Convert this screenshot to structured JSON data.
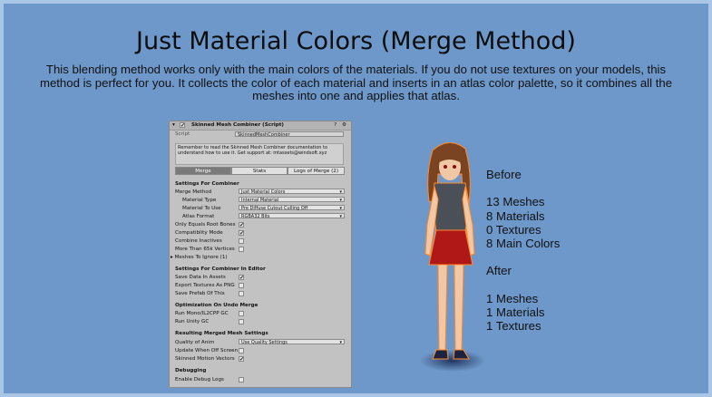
{
  "heading": "Just Material Colors (Merge Method)",
  "description": "This blending method works only with the main colors of the materials. If you do not use textures on your models, this method is perfect for you. It collects the color of each material and inserts in an atlas color palette, so it combines all the meshes into one and applies that atlas.",
  "inspector": {
    "title": "Skinned Mesh Combiner (Script)",
    "script_label": "Script",
    "script_value": "SkinnedMeshCombiner",
    "note": "Remember to read the Skinned Mesh Combiner documentation to understand how to use it. Get support at: mtassets@windsoft.xyz",
    "tabs": [
      "Merge",
      "Stats",
      "Logs of Merge (2)"
    ],
    "settings_header": "Settings For Combiner",
    "merge_method_label": "Merge Method",
    "merge_method_value": "Just Material Colors",
    "material_type_label": "Material Type",
    "material_type_value": "Internal Material",
    "material_to_use_label": "Material To Use",
    "material_to_use_value": "Pre Diffuse Cutout Culling Off",
    "atlas_format_label": "Atlas Format",
    "atlas_format_value": "RGBA32 Bits",
    "only_equals_root_bones": "Only Equals Root Bones",
    "compatibility_mode": "Compatiblity Mode",
    "combine_inactives": "Combine Inactives",
    "more_than_65k": "More Than 65k Vertices",
    "meshes_to_ignore": "Meshes To Ignore (1)",
    "editor_header": "Settings For Combiner In Editor",
    "save_data_in_assets": "Save Data In Assets",
    "export_textures_png": "Export Textures As PNG",
    "save_prefab": "Save Prefab Of This",
    "undo_header": "Optimization On Undo Merge",
    "run_mono_gc": "Run Mono/IL2CPP GC",
    "run_unity_gc": "Run Unity GC",
    "result_header": "Resulting Merged Mesh Settings",
    "quality_of_anim_label": "Quality of Anim",
    "quality_of_anim_value": "Use Quality Settings",
    "update_when_offscreen": "Update When Off Screen",
    "skinned_motion_vectors": "Skinned Motion Vectors",
    "debug_header": "Debugging",
    "enable_debug_logs": "Enable Debug Logs"
  },
  "stats": {
    "before_label": "Before",
    "before_meshes": "13 Meshes",
    "before_materials": "8 Materials",
    "before_textures": "0 Textures",
    "before_main_colors": "8 Main Colors",
    "after_label": "After",
    "after_meshes": "1 Meshes",
    "after_materials": "1 Materials",
    "after_textures": "1 Textures"
  },
  "colors": {
    "background": "#6d98c9",
    "border": "#a9c6e6",
    "inspector": "#c2c2c2"
  }
}
